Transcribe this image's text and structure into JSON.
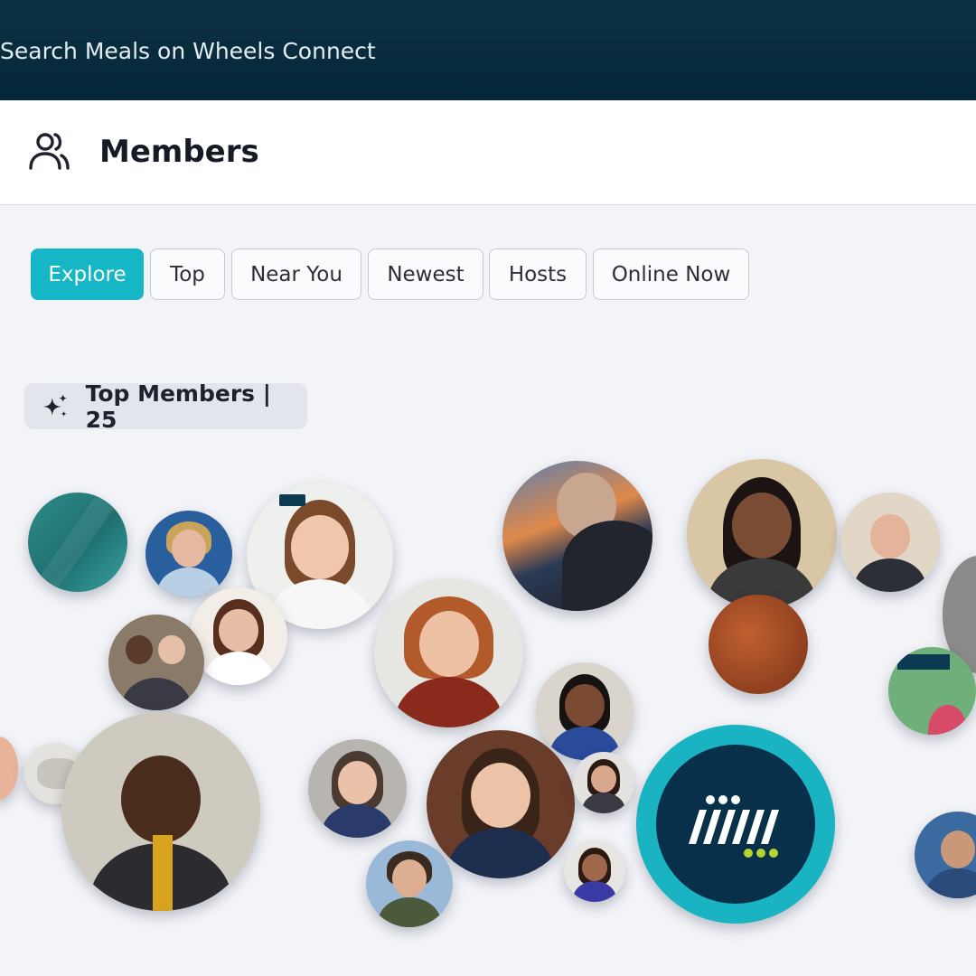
{
  "search": {
    "placeholder": "Search Meals on Wheels Connect"
  },
  "header": {
    "title": "Members",
    "icon": "users-icon"
  },
  "tabs": [
    {
      "label": "Explore",
      "active": true
    },
    {
      "label": "Top",
      "active": false
    },
    {
      "label": "Near You",
      "active": false
    },
    {
      "label": "Newest",
      "active": false
    },
    {
      "label": "Hosts",
      "active": false
    },
    {
      "label": "Online Now",
      "active": false
    }
  ],
  "top_members": {
    "label": "Top Members | 25",
    "icon": "sparkle-icon"
  },
  "colors": {
    "topbar": "#04283a",
    "accent": "#15b6c6",
    "page_bg": "#f3f4f8",
    "logo_ring": "#19b3c1",
    "logo_core": "#08304a",
    "logo_dots": "#b6d233"
  }
}
